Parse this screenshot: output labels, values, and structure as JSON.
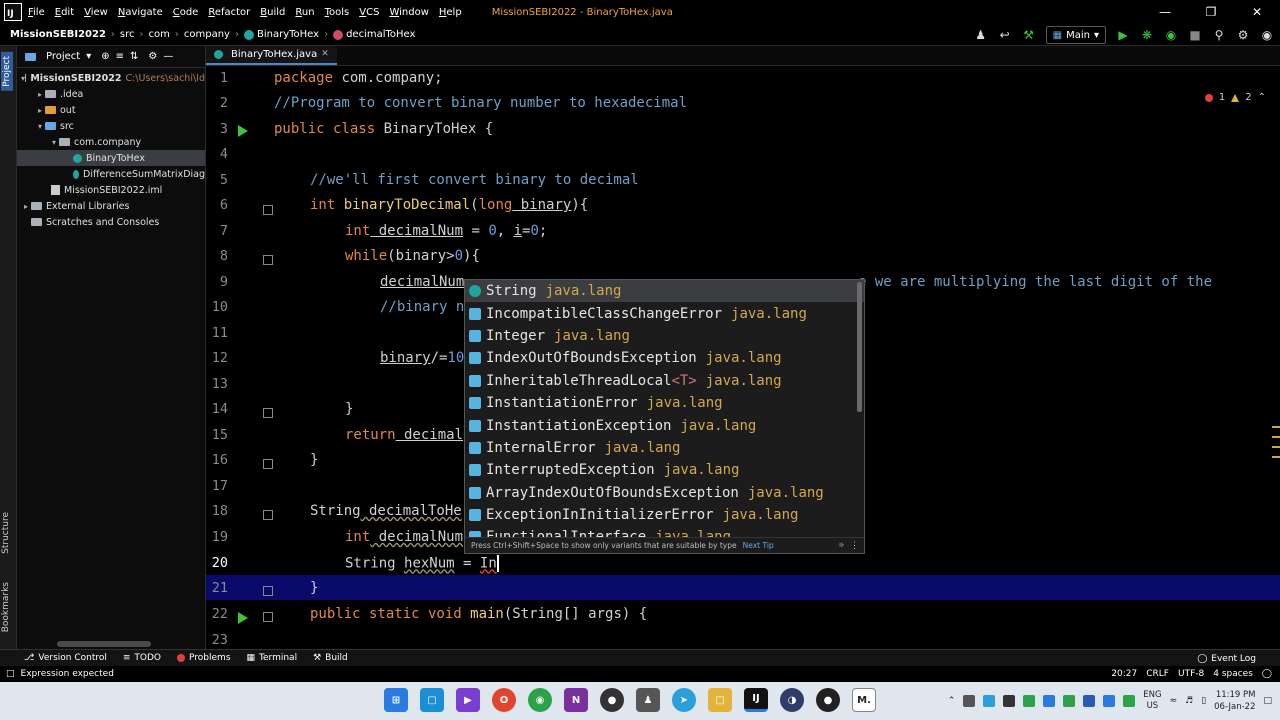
{
  "menubar": {
    "items": [
      "File",
      "Edit",
      "View",
      "Navigate",
      "Code",
      "Refactor",
      "Build",
      "Run",
      "Tools",
      "VCS",
      "Window",
      "Help"
    ],
    "window_title": "MissionSEBI2022 - BinaryToHex.java"
  },
  "navbar": {
    "crumbs": [
      "MissionSEBI2022",
      "src",
      "com",
      "company",
      "BinaryToHex",
      "decimalToHex"
    ],
    "run_config": "Main"
  },
  "project_panel": {
    "title": "Project",
    "tree": [
      {
        "label": "MissionSEBI2022",
        "hint": "C:\\Users\\sachi\\Id"
      },
      {
        "label": ".idea"
      },
      {
        "label": "out"
      },
      {
        "label": "src"
      },
      {
        "label": "com.company"
      },
      {
        "label": "BinaryToHex"
      },
      {
        "label": "DifferenceSumMatrixDiag"
      },
      {
        "label": "MissionSEBI2022.iml"
      },
      {
        "label": "External Libraries"
      },
      {
        "label": "Scratches and Consoles"
      }
    ]
  },
  "side_tabs": {
    "project": "Project",
    "structure": "Structure",
    "bookmarks": "Bookmarks"
  },
  "editor": {
    "tab_label": "BinaryToHex.java",
    "line_numbers": [
      "1",
      "2",
      "3",
      "4",
      "5",
      "6",
      "7",
      "8",
      "9",
      "10",
      "11",
      "12",
      "13",
      "14",
      "15",
      "16",
      "17",
      "18",
      "19",
      "20",
      "21",
      "22",
      "23"
    ],
    "inspection": {
      "errors": "1",
      "warnings": "2"
    },
    "code": {
      "l1_kw": "package",
      "l1_rest": " com.company;",
      "l2": "//Program to convert binary number to hexadecimal",
      "l3_kw": "public class",
      "l3_rest": " BinaryToHex {",
      "l5": "//we'll first convert binary to decimal",
      "l6_kw": "int",
      "l6_fn": " binaryToDecimal",
      "l6_p1": "(",
      "l6_kw2": "long",
      "l6_p2": " binary",
      "l6_p3": "){",
      "l7_kw": "int",
      "l7_v": " decimalNum",
      "l7_a": " = ",
      "l7_n1": "0",
      "l7_b": ", ",
      "l7_i": "i",
      "l7_c": "=",
      "l7_n2": "0",
      "l7_d": ";",
      "l8_kw": "while",
      "l8_a": "(binary>",
      "l8_n": "0",
      "l8_b": "){",
      "l9_v": "decimalNum",
      "l9_tail": "e we are multiplying the last digit of the",
      "l10": "//binary n",
      "l12_v": "binary",
      "l12_a": "/=",
      "l12_n": "10",
      "l14": "}",
      "l15_kw": "return",
      "l15_v": " decimal",
      "l16": "}",
      "l18_t": "String",
      "l18_v": " decimalToHe",
      "l19_kw": "int",
      "l19_v": " decimalNum",
      "l20_t": "String",
      "l20_v": "hexNum",
      "l20_a": " = ",
      "l20_typed": "In",
      "l21": "}",
      "l22_kw": "public static void",
      "l22_fn": " main",
      "l22_rest": "(String[] args) {"
    }
  },
  "completion": {
    "items": [
      {
        "name": "String",
        "pkg": "java.lang"
      },
      {
        "name": "IncompatibleClassChangeError",
        "pkg": "java.lang"
      },
      {
        "name": "Integer",
        "pkg": "java.lang"
      },
      {
        "name": "IndexOutOfBoundsException",
        "pkg": "java.lang"
      },
      {
        "name": "InheritableThreadLocal",
        "generic": "<T>",
        "pkg": "java.lang"
      },
      {
        "name": "InstantiationError",
        "pkg": "java.lang"
      },
      {
        "name": "InstantiationException",
        "pkg": "java.lang"
      },
      {
        "name": "InternalError",
        "pkg": "java.lang"
      },
      {
        "name": "InterruptedException",
        "pkg": "java.lang"
      },
      {
        "name": "ArrayIndexOutOfBoundsException",
        "pkg": "java.lang"
      },
      {
        "name": "ExceptionInInitializerError",
        "pkg": "java.lang"
      },
      {
        "name": "FunctionalInterface",
        "pkg": "java.lang"
      }
    ],
    "footer": "Press Ctrl+Shift+Space to show only variants that are suitable by type",
    "next_tip": "Next Tip"
  },
  "bottom_tools": {
    "items": [
      "Version Control",
      "TODO",
      "Problems",
      "Terminal",
      "Build"
    ],
    "event_log": "Event Log"
  },
  "status": {
    "message": "Expression expected",
    "position": "20:27",
    "line_sep": "CRLF",
    "encoding": "UTF-8",
    "indent": "4 spaces"
  },
  "taskbar": {
    "lang_top": "ENG",
    "lang_bottom": "US",
    "time": "11:19 PM",
    "date": "06-Jan-22"
  },
  "colors": {
    "keyword": "#e0864a",
    "comment": "#6f9fc5",
    "number": "#6c9cde",
    "method": "#f0cc6f",
    "package_hint": "#d4a84a",
    "caret_line": "#0a0a6b",
    "title_accent": "#f1a33c"
  }
}
